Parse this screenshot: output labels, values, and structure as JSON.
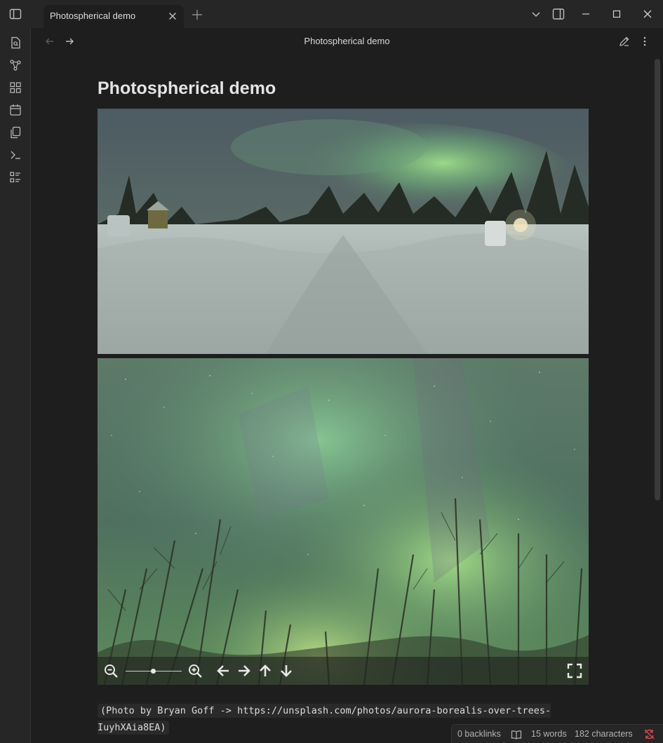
{
  "tab": {
    "title": "Photospherical demo"
  },
  "view": {
    "title": "Photospherical demo"
  },
  "document": {
    "title": "Photospherical demo",
    "caption": "(Photo by Bryan Goff -> https://unsplash.com/photos/aurora-borealis-over-trees-IuyhXAia8EA)"
  },
  "photos": {
    "panorama": "aurora-panorama-image",
    "viewer": "aurora-sphere-viewer"
  },
  "status": {
    "backlinks": "0 backlinks",
    "words": "15 words",
    "characters": "182 characters"
  },
  "colors": {
    "app_bg": "#1e1e1e",
    "chrome_bg": "#262626",
    "aurora_green": "#7fcf8a",
    "sync_error": "#e5484d"
  }
}
